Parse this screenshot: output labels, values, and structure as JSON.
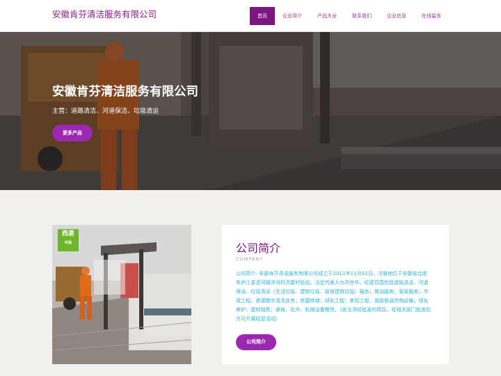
{
  "header": {
    "logo_text": "安徽肯芬清洁服务有限公司",
    "nav": [
      {
        "label": "首页",
        "active": true
      },
      {
        "label": "企业简介"
      },
      {
        "label": "产品大全"
      },
      {
        "label": "联系我们"
      },
      {
        "label": "企业信息"
      },
      {
        "label": "在线留言"
      }
    ]
  },
  "hero": {
    "title": "安徽肯芬清洁服务有限公司",
    "subtitle": "主营：道路清洁、河道保洁、垃圾清运",
    "button_label": "更多产品"
  },
  "about": {
    "image_logo_text": "西易",
    "image_logo_subtext": "环保",
    "title": "公司简介",
    "title_en": "COMPANY",
    "text": "公司简介: 安徽肯芬清洁服务有限公司成立于2011年11月02日，注册地位于安徽省合肥市庐江县泥河镇洋河村洪屋村民组，法定代表人为洪世华。经营范围包括道路清洁、河道保洁、垃圾清运（生活垃圾、建筑垃圾、装修建筑垃圾）服务；保洁服务；家政服务；市政工程；承接楼宇清洗业务；房屋修缮；绿化工程；景观工程；道路普通货物运输；绿化养护；建材销售；桌椅、花卉、机械设备租赁。（依法须经批准的项目，经相关部门批准后方可开展经营活动）",
    "button_label": "公司简介"
  },
  "colors": {
    "brand": "#7d1780",
    "button": "#9c27b0",
    "body_text": "#2bb3dd",
    "page_bg": "#f3f1ee"
  }
}
